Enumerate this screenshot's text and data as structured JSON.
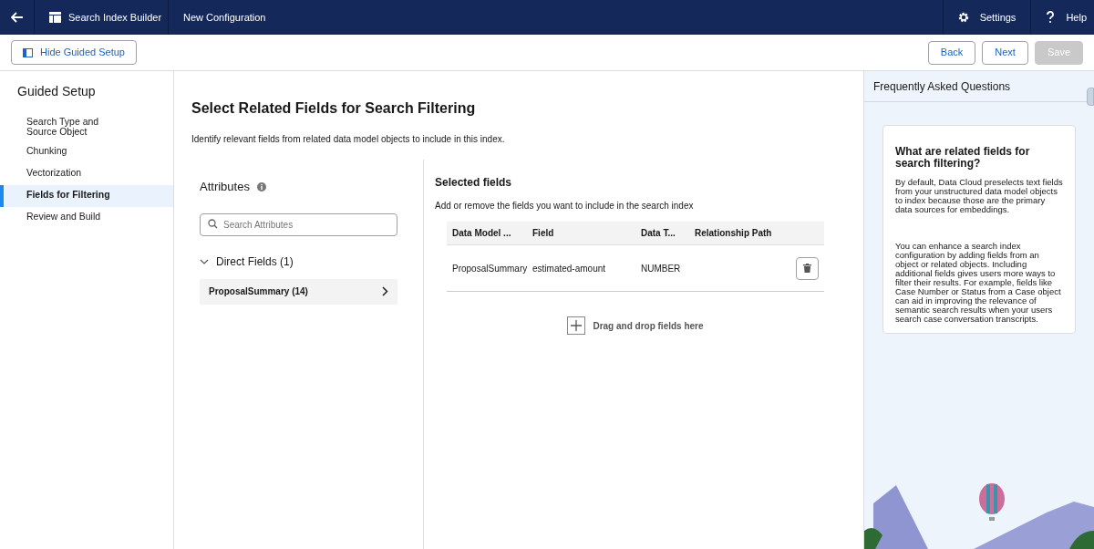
{
  "top_bar": {
    "app_name": "Search Index Builder",
    "page_title": "New Configuration",
    "actions": [
      {
        "kind": "settings",
        "label": "Settings"
      },
      {
        "kind": "help",
        "label": "Help"
      }
    ]
  },
  "toolbar": {
    "toggle_label": "Hide Guided Setup",
    "buttons": [
      {
        "label": "Back",
        "disabled": false
      },
      {
        "label": "Next",
        "disabled": false
      },
      {
        "label": "Save",
        "disabled": true
      }
    ]
  },
  "sidebar": {
    "title": "Guided Setup",
    "items": [
      {
        "label": "Search Type and Source Object",
        "selected": false
      },
      {
        "label": "Chunking",
        "selected": false
      },
      {
        "label": "Vectorization",
        "selected": false
      },
      {
        "label": "Fields for Filtering",
        "selected": true
      },
      {
        "label": "Review and Build",
        "selected": false
      }
    ]
  },
  "main": {
    "title": "Select Related Fields for Search Filtering",
    "description": "Identify relevant fields from related data model objects to include in this index.",
    "attributes": {
      "title": "Attributes",
      "search_placeholder": "Search Attributes",
      "group": {
        "label": "Direct Fields (1)",
        "expanded": true,
        "items": [
          {
            "label": "ProposalSummary (14)"
          }
        ]
      }
    },
    "selected_fields": {
      "title": "Selected fields",
      "description": "Add or remove the fields you want to include in the search index",
      "columns": [
        "Data Model ...",
        "Field",
        "Data T...",
        "Relationship Path"
      ],
      "rows": [
        {
          "cells": [
            "ProposalSummary",
            "estimated-amount",
            "NUMBER",
            ""
          ]
        }
      ],
      "drop_hint": "Drag and drop fields here"
    }
  },
  "faq": {
    "title": "Frequently Asked Questions",
    "card_title": "What are related fields for search filtering?",
    "paragraphs": [
      "By default, Data Cloud preselects text fields from your unstructured data model objects to index because those are the primary data sources for embeddings.",
      "You can enhance a search index configuration by adding fields from an object or related objects. Including additional fields gives users more ways to filter their results. For example, fields like Case Number or Status from a Case object can aid in improving the relevance of semantic search results when your users search case conversation transcripts."
    ]
  }
}
